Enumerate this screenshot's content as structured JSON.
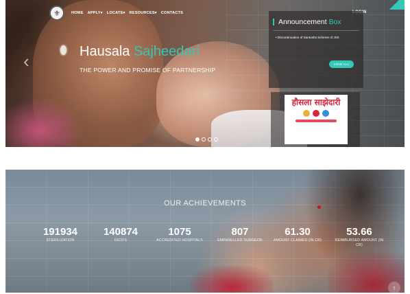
{
  "nav": {
    "items": [
      {
        "label": "HOME"
      },
      {
        "label": "APPLY▾"
      },
      {
        "label": "LOCATE▾"
      },
      {
        "label": "RESOURCES▾"
      },
      {
        "label": "CONTACTS"
      }
    ],
    "login": "LOGIN"
  },
  "hero": {
    "title_main": "Hausala ",
    "title_accent": "Sajheedari",
    "subtitle": "THE POWER AND PROMISE OF PARTNERSHIP",
    "prev_arrow": "‹",
    "slides_count": 4,
    "active_slide": 1
  },
  "announcement": {
    "title_main": "Announcement ",
    "title_accent": "Box",
    "item": "Discontinuation of Santushti Scheme of JSK",
    "button_label": "VIEW ALL"
  },
  "promo": {
    "hindi_text": "हौसला साझेदारी"
  },
  "achievements": {
    "title": "OUR ACHIEVEMENTS",
    "stats": [
      {
        "value": "191934",
        "label": "STERILIZATION"
      },
      {
        "value": "140874",
        "label": "IUCD'S"
      },
      {
        "value": "1075",
        "label": "ACCREDITED HOSPITALS"
      },
      {
        "value": "807",
        "label": "EMPANELLED SURGEON"
      },
      {
        "value": "61.30",
        "label": "AMOUNT CLAIMED (IN CR)"
      },
      {
        "value": "53.66",
        "label": "REIMBURSED AMOUNT (IN CR)"
      }
    ]
  },
  "scroll_top_icon": "↑",
  "colors": {
    "accent": "#35c7b7",
    "promo_red": "#d7263d"
  }
}
